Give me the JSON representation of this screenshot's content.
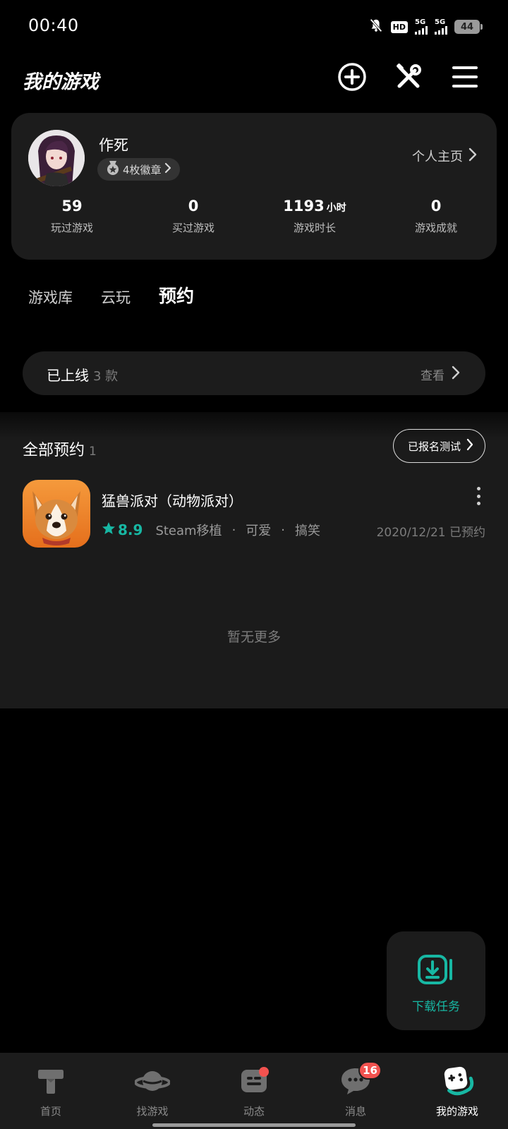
{
  "status_bar": {
    "time": "00:40",
    "hd_label": "HD",
    "signal_1_label": "5G",
    "signal_2_label": "5G",
    "battery_level": "44"
  },
  "header": {
    "title": "我的游戏",
    "icons": [
      "add-circle-icon",
      "tools-icon",
      "menu-icon"
    ]
  },
  "profile": {
    "username": "作死",
    "badges_label": "4枚徽章",
    "homepage_label": "个人主页",
    "stats": [
      {
        "value": "59",
        "unit": "",
        "label": "玩过游戏"
      },
      {
        "value": "0",
        "unit": "",
        "label": "买过游戏"
      },
      {
        "value": "1193",
        "unit": "小时",
        "label": "游戏时长"
      },
      {
        "value": "0",
        "unit": "",
        "label": "游戏成就"
      }
    ]
  },
  "tabs": [
    {
      "label": "游戏库",
      "active": false
    },
    {
      "label": "云玩",
      "active": false
    },
    {
      "label": "预约",
      "active": true
    }
  ],
  "released": {
    "label": "已上线",
    "count": "3 款",
    "action": "查看"
  },
  "reservations": {
    "title": "全部预约",
    "count": "1",
    "test_button": "已报名测试",
    "games": [
      {
        "name": "猛兽派对（动物派对）",
        "rating": "8.9",
        "tags": [
          "Steam移植",
          "可爱",
          "搞笑"
        ],
        "separator": "·",
        "date": "2020/12/21 已预约"
      }
    ],
    "no_more": "暂无更多"
  },
  "download_fab": {
    "label": "下载任务"
  },
  "bottom_nav": [
    {
      "label": "首页",
      "icon": "home-icon"
    },
    {
      "label": "找游戏",
      "icon": "planet-icon"
    },
    {
      "label": "动态",
      "icon": "feed-icon"
    },
    {
      "label": "消息",
      "icon": "message-icon",
      "badge": "16"
    },
    {
      "label": "我的游戏",
      "icon": "gamepad-icon"
    }
  ],
  "colors": {
    "accent": "#17b7a3",
    "background": "#000000",
    "card": "#1c1c1c",
    "badge_red": "#f2524f"
  }
}
